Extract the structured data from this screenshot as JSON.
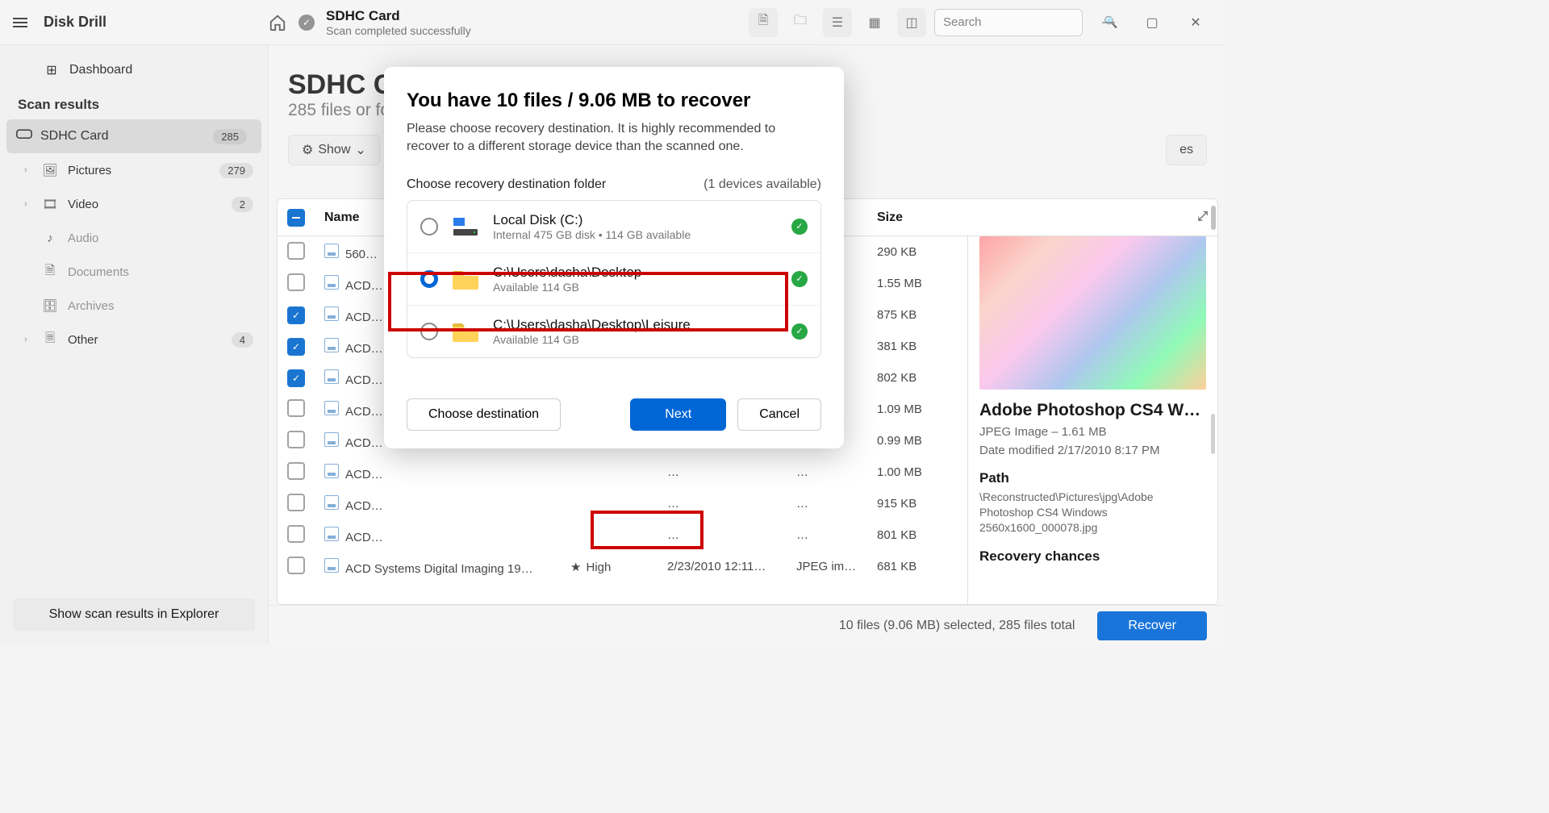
{
  "app": {
    "title": "Disk Drill"
  },
  "sidebar": {
    "dashboard": "Dashboard",
    "header": "Scan results",
    "items": [
      {
        "label": "SDHC Card",
        "badge": "285"
      },
      {
        "label": "Pictures",
        "badge": "279"
      },
      {
        "label": "Video",
        "badge": "2"
      },
      {
        "label": "Audio"
      },
      {
        "label": "Documents"
      },
      {
        "label": "Archives"
      },
      {
        "label": "Other",
        "badge": "4"
      }
    ],
    "explorer_btn": "Show scan results in Explorer"
  },
  "header": {
    "title": "SDHC Card",
    "subtitle": "Scan completed successfully",
    "search_placeholder": "Search"
  },
  "main": {
    "title": "SDHC Card",
    "subtitle": "285 files or folders",
    "chips": {
      "show": "Show",
      "other": "es"
    }
  },
  "table": {
    "cols": {
      "name": "Name",
      "size": "Size"
    },
    "chances": {
      "high": "High"
    },
    "rows": [
      {
        "name": "560…",
        "date": "…",
        "type": "…",
        "size": "290 KB",
        "checked": false
      },
      {
        "name": "ACD…",
        "date": "…",
        "type": "…",
        "size": "1.55 MB",
        "checked": false
      },
      {
        "name": "ACD…",
        "date": "…",
        "type": "…",
        "size": "875 KB",
        "checked": true
      },
      {
        "name": "ACD…",
        "date": "…",
        "type": "…",
        "size": "381 KB",
        "checked": true
      },
      {
        "name": "ACD…",
        "date": "…",
        "type": "…",
        "size": "802 KB",
        "checked": true
      },
      {
        "name": "ACD…",
        "date": "…",
        "type": "…",
        "size": "1.09 MB",
        "checked": false
      },
      {
        "name": "ACD…",
        "date": "…",
        "type": "…",
        "size": "0.99 MB",
        "checked": false
      },
      {
        "name": "ACD…",
        "date": "…",
        "type": "…",
        "size": "1.00 MB",
        "checked": false
      },
      {
        "name": "ACD…",
        "date": "…",
        "type": "…",
        "size": "915 KB",
        "checked": false
      },
      {
        "name": "ACD…",
        "date": "…",
        "type": "…",
        "size": "801 KB",
        "checked": false
      },
      {
        "name": "ACD Systems Digital Imaging 19…",
        "date": "2/23/2010 12:11…",
        "type": "JPEG im…",
        "size": "681 KB",
        "checked": false
      }
    ]
  },
  "preview": {
    "title": "Adobe Photoshop CS4 W…",
    "type_line": "JPEG Image – 1.61 MB",
    "date_line": "Date modified 2/17/2010 8:17 PM",
    "path_label": "Path",
    "path_value": "\\Reconstructed\\Pictures\\jpg\\Adobe Photoshop CS4 Windows 2560x1600_000078.jpg",
    "chances_label": "Recovery chances"
  },
  "status": {
    "text": "10 files (9.06 MB) selected, 285 files total",
    "recover": "Recover"
  },
  "modal": {
    "title": "You have 10 files / 9.06 MB to recover",
    "desc": "Please choose recovery destination. It is highly recommended to recover to a different storage device than the scanned one.",
    "dest_label": "Choose recovery destination folder",
    "dev_hint": "(1 devices available)",
    "destinations": [
      {
        "name": "Local Disk (C:)",
        "sub": "Internal 475 GB disk • 114 GB available",
        "selected": false
      },
      {
        "name": "C:\\Users\\dasha\\Desktop",
        "sub": "Available 114 GB",
        "selected": true
      },
      {
        "name": "C:\\Users\\dasha\\Desktop\\Leisure",
        "sub": "Available 114 GB",
        "selected": false
      }
    ],
    "choose": "Choose destination",
    "next": "Next",
    "cancel": "Cancel"
  }
}
